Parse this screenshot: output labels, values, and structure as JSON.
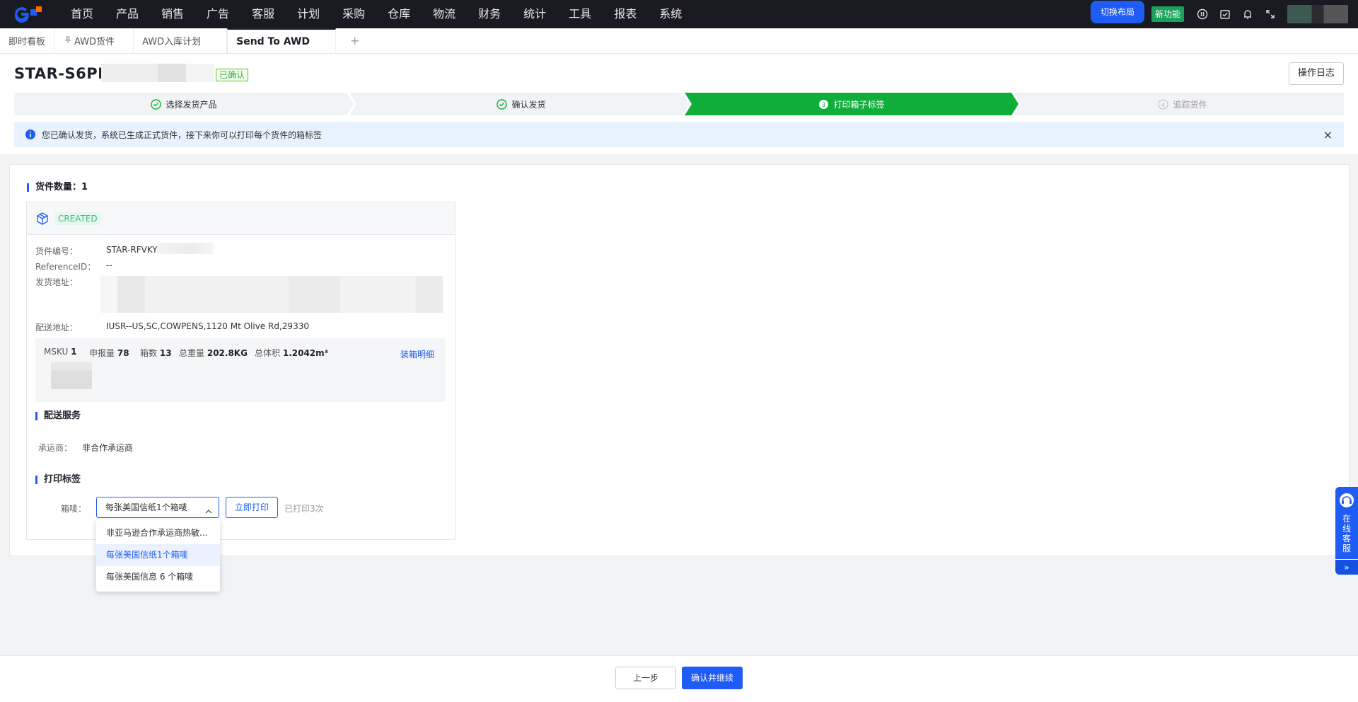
{
  "nav": {
    "items": [
      "首页",
      "产品",
      "销售",
      "广告",
      "客服",
      "计划",
      "采购",
      "仓库",
      "物流",
      "财务",
      "统计",
      "工具",
      "报表",
      "系统"
    ],
    "switch_layout": "切换布局",
    "new_feature": "新功能"
  },
  "tabs": {
    "items": [
      "即时看板",
      "AWD货件",
      "AWD入库计划"
    ],
    "active": "Send To AWD",
    "add": "+"
  },
  "header": {
    "title": "STAR-S6PB",
    "status": "已确认",
    "log_button": "操作日志"
  },
  "steps": [
    {
      "num": "1",
      "label": "选择发货产品",
      "state": "done"
    },
    {
      "num": "2",
      "label": "确认发货",
      "state": "done"
    },
    {
      "num": "3",
      "label": "打印箱子标签",
      "state": "active"
    },
    {
      "num": "4",
      "label": "追踪货件",
      "state": "todo"
    }
  ],
  "alert": {
    "text": "您已确认发货，系统已生成正式货件，接下来你可以打印每个货件的箱标签",
    "close": "×"
  },
  "main": {
    "count_label": "货件数量：",
    "count_value": "1",
    "shipment": {
      "status": "CREATED",
      "id_label": "货件编号：",
      "id_value": "STAR-RFVKY",
      "ref_label": "ReferenceID：",
      "ref_value": "--",
      "from_label": "发货地址：",
      "to_label": "配送地址：",
      "to_value": "IUSR--US,SC,COWPENS,1120 Mt Olive Rd,29330",
      "summary": {
        "msku_label": "MSKU",
        "msku_value": "1",
        "declared_label": "申报量",
        "declared_value": "78",
        "boxes_label": "箱数",
        "boxes_value": "13",
        "weight_label": "总重量",
        "weight_value": "202.8KG",
        "volume_label": "总体积",
        "volume_value": "1.2042m³",
        "detail_link": "装箱明细"
      },
      "delivery_title": "配送服务",
      "carrier_label": "承运商：",
      "carrier_value": "非合作承运商",
      "print_title": "打印标签",
      "label_label": "箱唛：",
      "label_selected": "每张美国信纸1个箱唛",
      "print_button": "立即打印",
      "printed_text": "已打印3次"
    }
  },
  "dropdown": {
    "options": [
      "非亚马逊合作承运商热敏...",
      "每张美国信纸1个箱唛",
      "每张美国信息 6 个箱唛"
    ]
  },
  "footer": {
    "prev": "上一步",
    "next": "确认并继续"
  },
  "service": {
    "text": "在线客服",
    "expand": "»"
  },
  "colors": {
    "primary": "#1f5cf5",
    "step_active": "#0fae3b",
    "nav_bg": "#1a1b22"
  }
}
